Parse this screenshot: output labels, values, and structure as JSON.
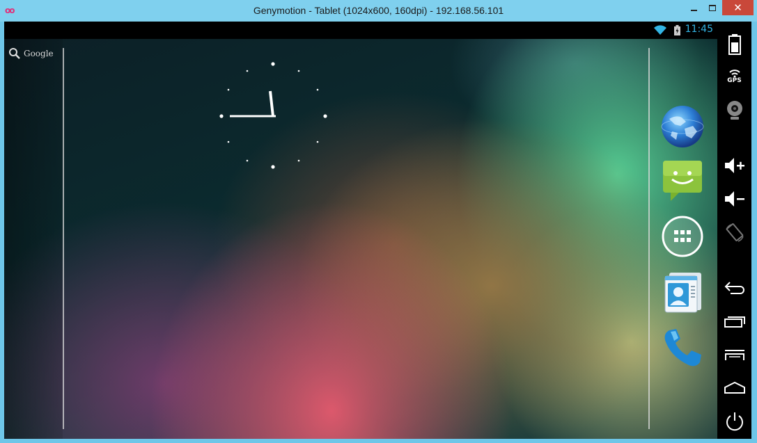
{
  "window": {
    "title": "Genymotion - Tablet (1024x600, 160dpi) - 192.168.56.101",
    "logo_text": "oo",
    "close_label": "✕"
  },
  "statusbar": {
    "time": "11:45",
    "wifi_icon": "wifi-icon",
    "battery_icon": "battery-charging-icon"
  },
  "search": {
    "label": "Google",
    "icon": "search-icon"
  },
  "clock": {
    "type": "analog",
    "hour": 11,
    "minute": 45
  },
  "dock": {
    "items": [
      {
        "name": "browser",
        "icon": "globe-icon"
      },
      {
        "name": "messaging",
        "icon": "messaging-icon"
      },
      {
        "name": "all-apps",
        "icon": "app-drawer-icon"
      },
      {
        "name": "contacts",
        "icon": "contacts-icon"
      },
      {
        "name": "phone",
        "icon": "phone-icon"
      }
    ]
  },
  "sidebar": {
    "gps_label": "GPS",
    "buttons": [
      "battery-icon",
      "gps-icon",
      "camera-icon",
      "volume-up-icon",
      "volume-down-icon",
      "rotate-icon",
      "back-icon",
      "recent-apps-icon",
      "menu-icon",
      "home-icon",
      "power-icon"
    ]
  },
  "colors": {
    "titlebar": "#7fd0ee",
    "close_button": "#c9483a",
    "status_time": "#33b5e5",
    "sidebar": "#000000"
  }
}
